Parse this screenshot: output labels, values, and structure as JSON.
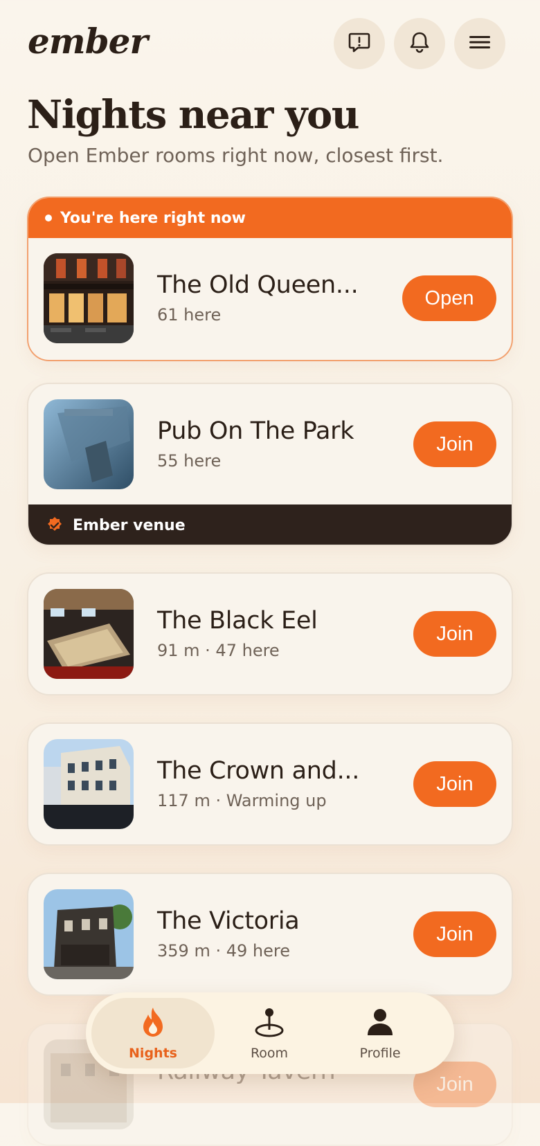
{
  "app": {
    "logo": "ember"
  },
  "header": {
    "icons": [
      "report-icon",
      "bell-icon",
      "menu-icon"
    ]
  },
  "page": {
    "title": "Nights near you",
    "subtitle": "Open Ember rooms right now, closest first."
  },
  "current": {
    "banner": "You're here right now",
    "name": "The Old Queen...",
    "sub": "61 here",
    "button": "Open"
  },
  "venues": [
    {
      "name": "Pub On The Park",
      "sub": "55 here",
      "button": "Join",
      "tag": "Ember venue"
    },
    {
      "name": "The Black Eel",
      "sub": "91 m · 47 here",
      "button": "Join"
    },
    {
      "name": "The Crown and...",
      "sub": "117 m · Warming up",
      "button": "Join"
    },
    {
      "name": "The Victoria",
      "sub": "359 m · 49 here",
      "button": "Join"
    },
    {
      "name": "Railway Tavern",
      "button": "Join"
    }
  ],
  "nav": {
    "items": [
      {
        "label": "Nights",
        "icon": "flame-icon",
        "active": true
      },
      {
        "label": "Room",
        "icon": "pin-icon",
        "active": false
      },
      {
        "label": "Profile",
        "icon": "person-icon",
        "active": false
      }
    ]
  },
  "colors": {
    "accent": "#f26a20",
    "dark": "#2e221c",
    "background": "#faf5ec"
  }
}
